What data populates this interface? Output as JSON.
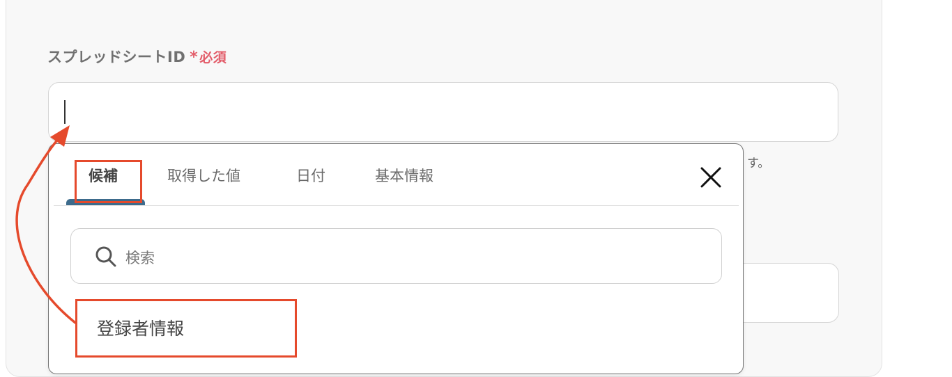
{
  "field": {
    "label": "スプレッドシートID",
    "required_mark": "*",
    "required_text": "必須",
    "value": ""
  },
  "help_text_tail": "す。",
  "dropdown": {
    "tabs": [
      {
        "label": "候補",
        "active": true
      },
      {
        "label": "取得した値",
        "active": false
      },
      {
        "label": "日付",
        "active": false
      },
      {
        "label": "基本情報",
        "active": false
      }
    ],
    "close_icon": "close-icon",
    "search": {
      "placeholder": "検索",
      "icon": "search-icon"
    },
    "options": [
      {
        "label": "登録者情報"
      }
    ]
  },
  "colors": {
    "accent_red": "#e54a2c",
    "required_red": "#e35d6a",
    "active_tab_underline": "#3d6b8c",
    "card_bg": "#f8f8f8"
  }
}
